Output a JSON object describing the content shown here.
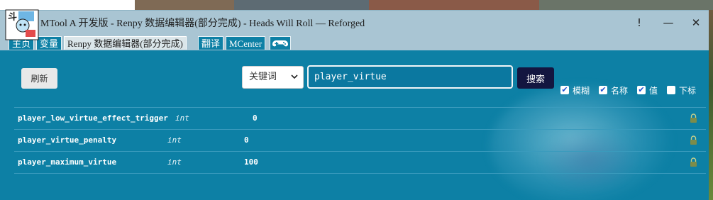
{
  "window": {
    "title": "MTool A 开发版 - Renpy 数据编辑器(部分完成) - Heads Will Roll — Reforged",
    "logo_text": "斗"
  },
  "titlebar_buttons": {
    "alert": "!",
    "minimize": "—",
    "close": "✕"
  },
  "tabs": [
    {
      "label": "主页",
      "active": false
    },
    {
      "label": "变量",
      "active": false
    },
    {
      "label": "Renpy 数据编辑器(部分完成)",
      "active": true
    },
    {
      "label": "翻译",
      "active": false
    },
    {
      "label": "MCenter",
      "active": false
    },
    {
      "label": "",
      "icon": "gamepad-icon",
      "active": false
    }
  ],
  "toolbar": {
    "refresh_label": "刷新",
    "search_mode": "关键词",
    "search_value": "player_virtue",
    "search_button": "搜索"
  },
  "options": [
    {
      "label": "模糊",
      "checked": true
    },
    {
      "label": "名称",
      "checked": true
    },
    {
      "label": "值",
      "checked": true
    },
    {
      "label": "下标",
      "checked": false
    }
  ],
  "variables": [
    {
      "name": "player_low_virtue_effect_trigger",
      "type": "int",
      "value": "0"
    },
    {
      "name": "player_virtue_penalty",
      "type": "int",
      "value": "0"
    },
    {
      "name": "player_maximum_virtue",
      "type": "int",
      "value": "100"
    }
  ],
  "colors": {
    "content_bg": "#0d80a5",
    "titlebar_bg": "#a9c5d3",
    "search_button_bg": "#131640",
    "lock_icon": "#7c8c4a"
  }
}
